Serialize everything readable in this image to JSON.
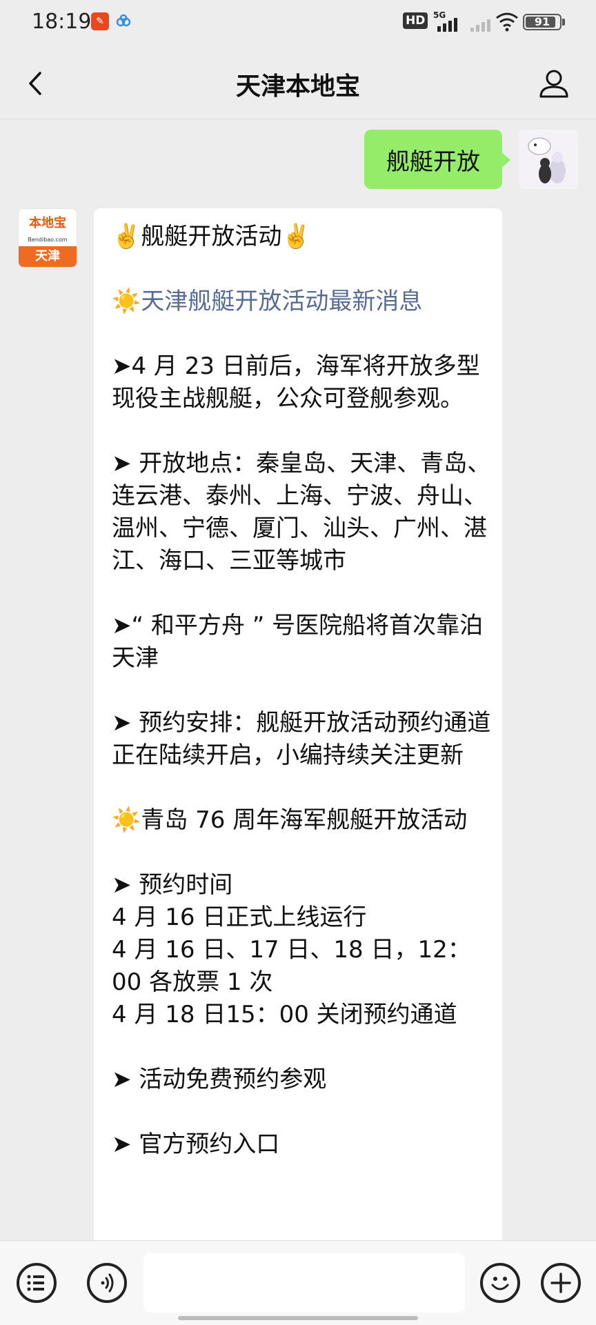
{
  "status_bar": {
    "time": "18:19",
    "app_badge": "",
    "network_hd": "HD",
    "network_type": "5G",
    "battery_level": 91,
    "battery_text": "91"
  },
  "header": {
    "title": "天津本地宝",
    "back_icon": "chevron-left",
    "profile_icon": "person-outline"
  },
  "outgoing": {
    "text": "舰艇开放"
  },
  "incoming": {
    "avatar_brand": "本地宝",
    "avatar_sub": "Bendibao.com",
    "avatar_city": "天津",
    "lines": [
      {
        "text": "✌️舰艇开放活动✌️",
        "type": "text"
      },
      {
        "text": "",
        "type": "blank"
      },
      {
        "text": "☀️天津舰艇开放活动最新消息",
        "type": "link"
      },
      {
        "text": "",
        "type": "blank"
      },
      {
        "text": "➤4 月 23 日前后，海军将开放多型现役主战舰艇，公众可登舰参观。",
        "type": "text"
      },
      {
        "text": "",
        "type": "blank"
      },
      {
        "text": "➤ 开放地点：秦皇岛、天津、青岛、连云港、泰州、上海、宁波、舟山、温州、宁德、厦门、汕头、广州、湛江、海口、三亚等城市",
        "type": "text"
      },
      {
        "text": "",
        "type": "blank"
      },
      {
        "text": "➤“ 和平方舟 ” 号医院船将首次靠泊天津",
        "type": "text"
      },
      {
        "text": "",
        "type": "blank"
      },
      {
        "text": "➤ 预约安排：舰艇开放活动预约通道正在陆续开启，小编持续关注更新",
        "type": "text"
      },
      {
        "text": "",
        "type": "blank"
      },
      {
        "text": "☀️青岛 76 周年海军舰艇开放活动",
        "type": "text"
      },
      {
        "text": "",
        "type": "blank"
      },
      {
        "text": "➤ 预约时间",
        "type": "text"
      },
      {
        "text": "4 月 16 日正式上线运行",
        "type": "text"
      },
      {
        "text": "4 月 16 日、17 日、18 日，12：00 各放票 1 次",
        "type": "text"
      },
      {
        "text": "4 月 18 日15：00 关闭预约通道",
        "type": "text"
      },
      {
        "text": "",
        "type": "blank"
      },
      {
        "text": "➤ 活动免费预约参观",
        "type": "text"
      },
      {
        "text": "",
        "type": "blank"
      },
      {
        "text": "➤ 官方预约入口",
        "type": "text"
      }
    ]
  },
  "bottom_bar": {
    "menu_icon": "list-circle",
    "voice_icon": "voice-circle",
    "input_value": "",
    "emoji_icon": "smiley-circle",
    "add_icon": "plus-circle"
  }
}
